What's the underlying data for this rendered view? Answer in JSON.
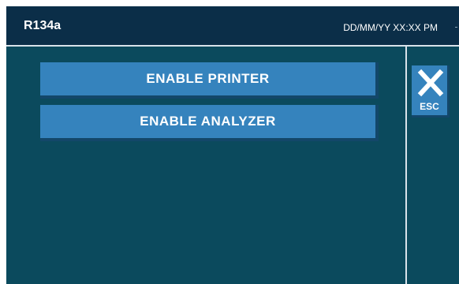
{
  "header": {
    "title": "R134a",
    "datetime": "DD/MM/YY XX:XX PM"
  },
  "menu": {
    "items": [
      {
        "label": "ENABLE PRINTER"
      },
      {
        "label": "ENABLE ANALYZER"
      }
    ]
  },
  "esc_button": {
    "label": "ESC",
    "icon": "close-icon"
  },
  "colors": {
    "header_bg": "#0b2e48",
    "screen_bg": "#0b4a5d",
    "button_bg": "#3583bd",
    "button_shadow": "#13476a",
    "text": "#ffffff"
  }
}
